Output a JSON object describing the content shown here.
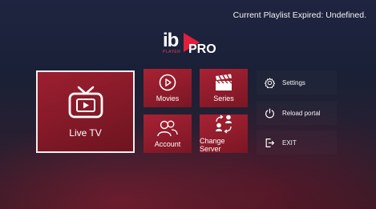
{
  "status": {
    "playlist_text": "Current Playlist Expired: Undefined."
  },
  "logo": {
    "ib": "ib",
    "pro": "PRO",
    "sub": "PLAYER"
  },
  "tiles": {
    "live_tv": "Live TV",
    "movies": "Movies",
    "series": "Series",
    "account": "Account",
    "change_server": "Change Server"
  },
  "menu": {
    "settings": "Settings",
    "reload": "Reload portal",
    "exit": "EXIT"
  },
  "colors": {
    "accent": "#a82234",
    "logo_red": "#e0203a"
  }
}
